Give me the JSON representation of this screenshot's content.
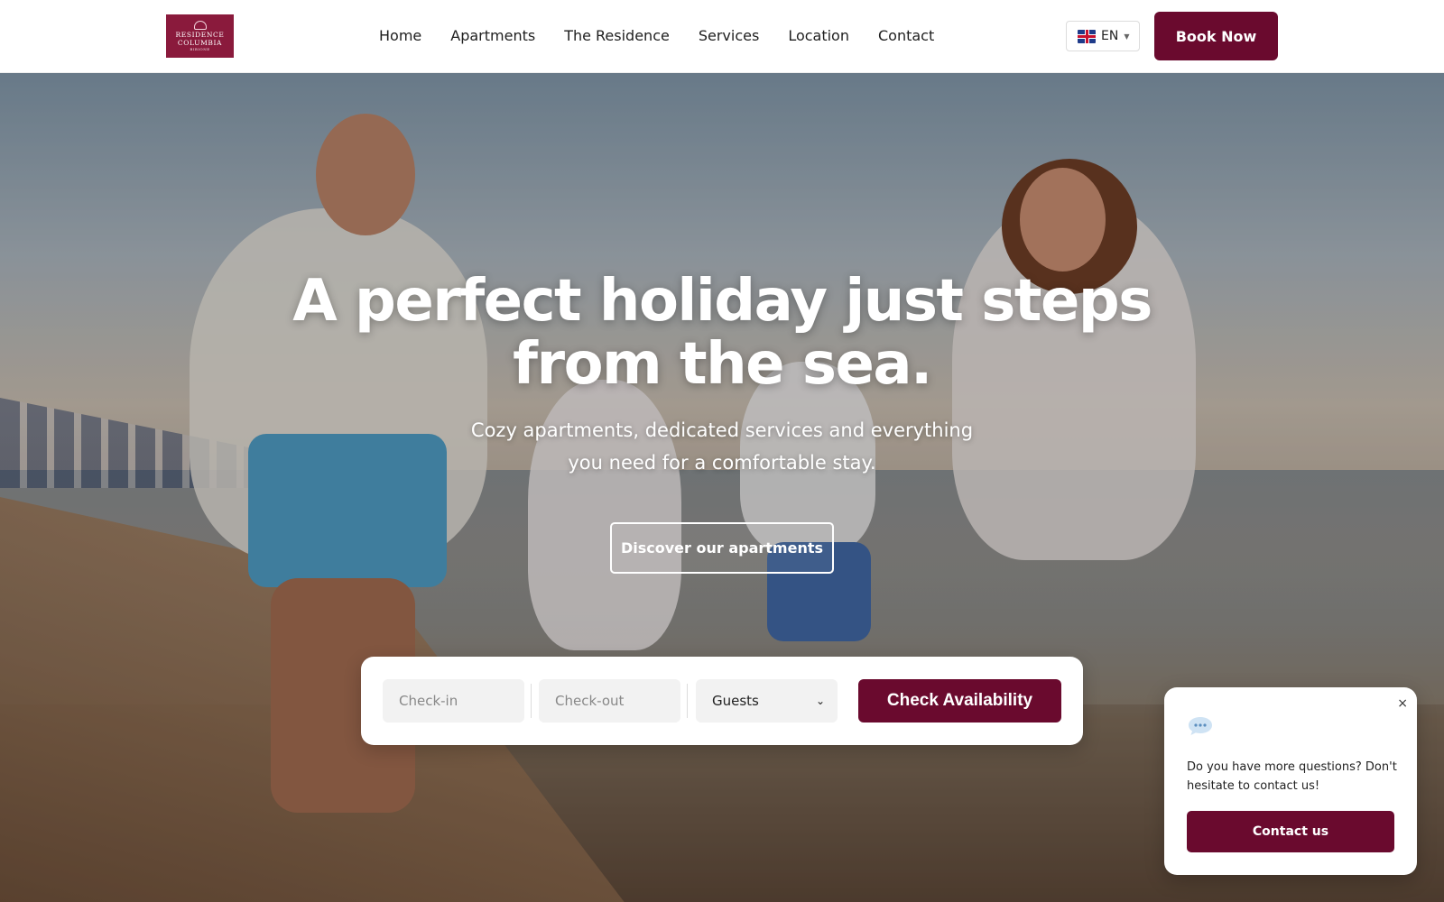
{
  "header": {
    "logo": {
      "line1": "RESIDENCE",
      "line2": "COLUMBIA",
      "line3": "BIBIONE"
    },
    "nav": [
      "Home",
      "Apartments",
      "The Residence",
      "Services",
      "Location",
      "Contact"
    ],
    "language": "EN",
    "book_label": "Book Now"
  },
  "hero": {
    "headline": "A perfect holiday just steps from the sea.",
    "subtitle": "Cozy apartments, dedicated services and everything you need for a comfortable stay.",
    "cta_label": "Discover our apartments"
  },
  "booking": {
    "checkin_placeholder": "Check-in",
    "checkout_placeholder": "Check-out",
    "guests_label": "Guests",
    "submit_label": "Check Availability"
  },
  "chat": {
    "close_label": "×",
    "message": "Do you have more questions? Don't hesitate to contact us!",
    "button_label": "Contact us"
  },
  "colors": {
    "brand": "#6a0a2e",
    "logo_bg": "#8a1a3c"
  },
  "icons": {
    "language_flag": "uk-flag-icon",
    "chat": "chat-bubble-icon",
    "close": "close-icon",
    "dropdown": "chevron-down-icon"
  }
}
